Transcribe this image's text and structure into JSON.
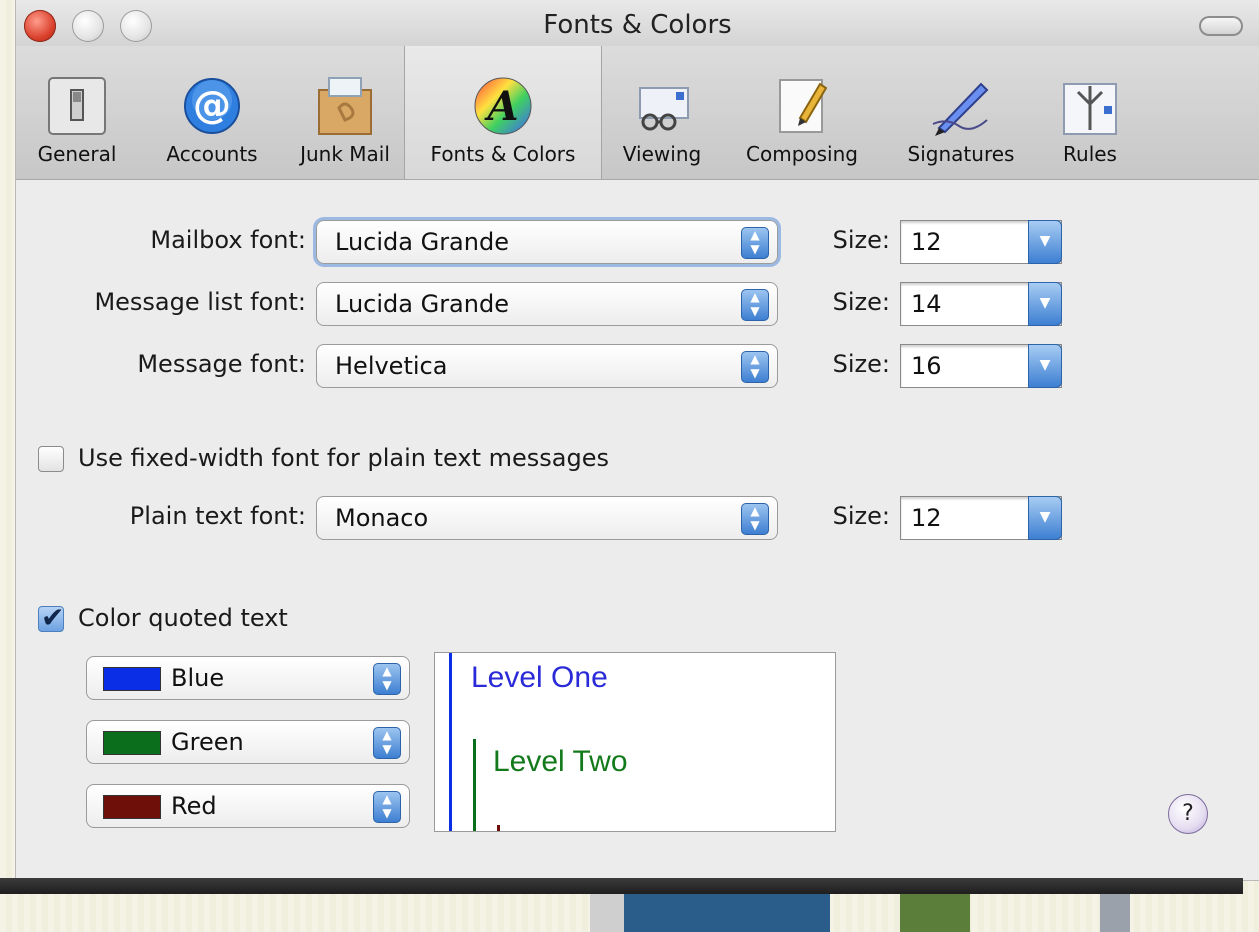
{
  "window": {
    "title": "Fonts & Colors"
  },
  "toolbar": {
    "tabs": [
      {
        "label": "General",
        "icon": "light-switch-icon"
      },
      {
        "label": "Accounts",
        "icon": "at-sign-icon"
      },
      {
        "label": "Junk Mail",
        "icon": "junk-box-icon"
      },
      {
        "label": "Fonts & Colors",
        "icon": "fonts-colors-icon",
        "selected": true
      },
      {
        "label": "Viewing",
        "icon": "glasses-envelope-icon"
      },
      {
        "label": "Composing",
        "icon": "pencil-paper-icon"
      },
      {
        "label": "Signatures",
        "icon": "fountain-pen-icon"
      },
      {
        "label": "Rules",
        "icon": "rules-arrows-icon"
      }
    ]
  },
  "fonts": {
    "mailbox": {
      "label": "Mailbox font:",
      "value": "Lucida Grande",
      "size_label": "Size:",
      "size": "12"
    },
    "message_list": {
      "label": "Message list font:",
      "value": "Lucida Grande",
      "size_label": "Size:",
      "size": "14"
    },
    "message": {
      "label": "Message font:",
      "value": "Helvetica",
      "size_label": "Size:",
      "size": "16"
    }
  },
  "fixed_width": {
    "checkbox_label": "Use fixed-width font for plain text messages",
    "checked": false,
    "plain_label": "Plain text font:",
    "value": "Monaco",
    "size_label": "Size:",
    "size": "12"
  },
  "quoted": {
    "checkbox_label": "Color quoted text",
    "checked": true,
    "levels": [
      {
        "name": "Blue",
        "color": "#0a2ee6"
      },
      {
        "name": "Green",
        "color": "#0a6e1c"
      },
      {
        "name": "Red",
        "color": "#6e0f0a"
      }
    ],
    "preview": {
      "level_one": "Level One",
      "level_two": "Level Two"
    }
  },
  "colors": {
    "level_one_text": "#2a2ad8",
    "level_two_text": "#137a1c"
  }
}
